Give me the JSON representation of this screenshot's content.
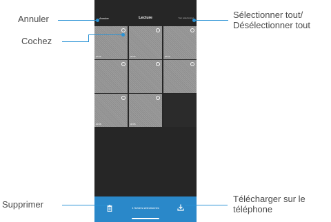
{
  "callouts": {
    "cancel": "Annuler",
    "check": "Cochez",
    "select_all_line1": "Sélectionner tout/",
    "select_all_line2": "Désélectionner tout",
    "delete": "Supprimer",
    "download_line1": "Télécharger sur le",
    "download_line2": "téléphone"
  },
  "phone": {
    "header": {
      "cancel_label": "Annuler",
      "title": "Lecture",
      "select_all_label": "Tout sélectionner"
    },
    "thumbnails": [
      {
        "duration": "00:20"
      },
      {
        "duration": "00:15"
      },
      {
        "duration": "00:10"
      },
      {
        "duration": ""
      },
      {
        "duration": ""
      },
      {
        "duration": ""
      },
      {
        "duration": "00:08"
      },
      {
        "duration": "00:05"
      },
      {
        "duration": ""
      }
    ],
    "footer": {
      "selected_count": "1 fichiers sélectionnés"
    }
  },
  "colors": {
    "accent": "#2a93d5",
    "phone_bg": "#262626",
    "footer_bg": "#2a88c9"
  },
  "icons": [
    "trash-icon",
    "download-icon",
    "checkbox-circle-icon"
  ]
}
